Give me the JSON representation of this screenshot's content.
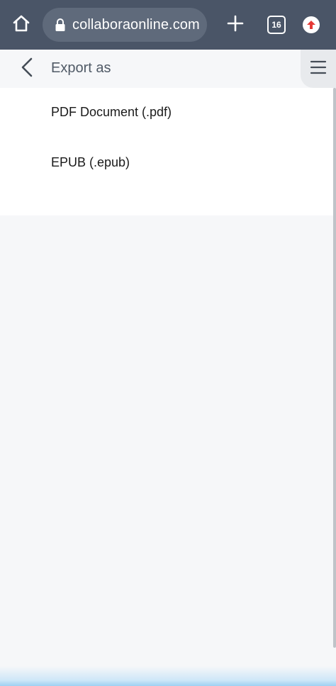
{
  "browser": {
    "url": "collaboraonline.com",
    "tab_count": "16",
    "icons": {
      "home": "home-icon",
      "lock": "lock-icon",
      "new_tab": "plus-icon",
      "tabs": "tabs-icon",
      "update": "update-icon"
    },
    "colors": {
      "bar": "#4a5567",
      "pill": "#5f6a7b",
      "update_arrow": "#e53935"
    }
  },
  "header": {
    "title": "Export as",
    "icons": {
      "back": "chevron-left-icon",
      "menu": "hamburger-menu-icon"
    }
  },
  "export_options": [
    {
      "label": "PDF Document (.pdf)"
    },
    {
      "label": "EPUB (.epub)"
    }
  ]
}
